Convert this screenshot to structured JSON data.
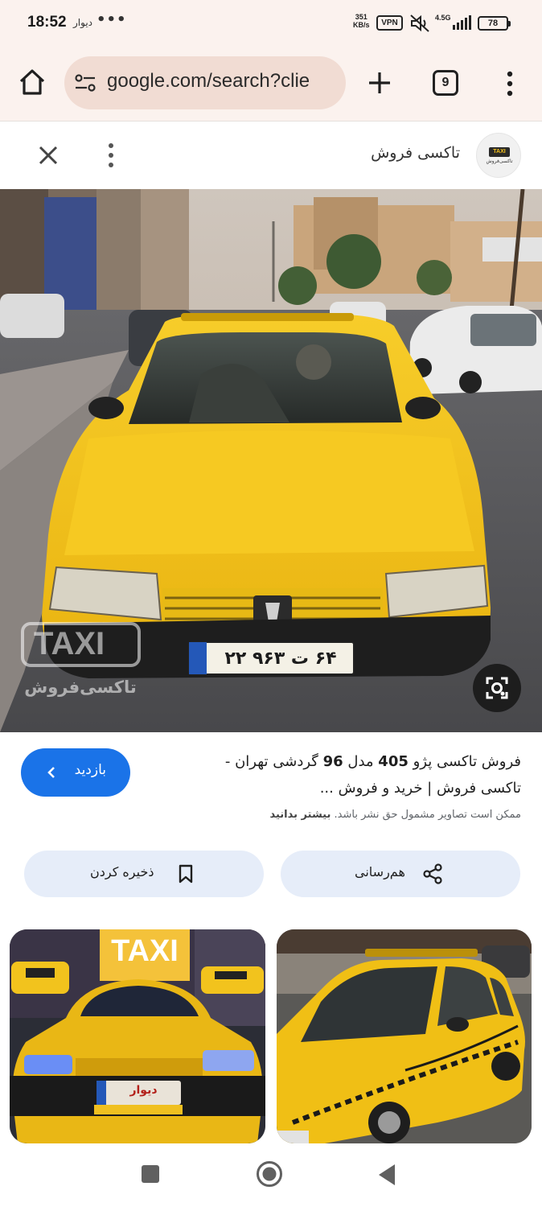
{
  "status_bar": {
    "time": "18:52",
    "app_label": "دیوار",
    "more_dots": "•••",
    "speed_top": "351",
    "speed_bottom": "KB/s",
    "vpn": "VPN",
    "network": "4.5G",
    "battery": "78"
  },
  "browser": {
    "url": "google.com/search?clie",
    "tab_count": "9"
  },
  "panel": {
    "site_name": "تاکسی فروش",
    "logo_text": "TAXI",
    "logo_sub": "تاکسی‌فروش"
  },
  "result": {
    "title_part1": "فروش تاکسی پژو ",
    "title_bold1": "405",
    "title_part2": " مدل ",
    "title_bold2": "96",
    "title_part3": " گردشی تهران -",
    "title_line2": "تاکسی فروش | خرید و فروش ...",
    "visit_label": "بازدید",
    "copyright_text": "ممکن است تصاویر مشمول حق نشر باشد.",
    "learn_more": "بیشتر بدانید"
  },
  "actions": {
    "share_label": "هم‌رسانی",
    "save_label": "ذخیره کردن"
  },
  "image_text": {
    "watermark_en": "TAXI",
    "watermark_fa": "تاکسی‌فروش",
    "plate": "۶۴ ت ۹۶۳ ۲۲",
    "thumb_sign": "TAXI",
    "thumb_plate": "دیوار"
  },
  "colors": {
    "taxi_yellow": "#f5c518",
    "accent_blue": "#1a73e8",
    "chip_bg": "#e6edf9",
    "browser_bg": "#fbf2ee"
  }
}
